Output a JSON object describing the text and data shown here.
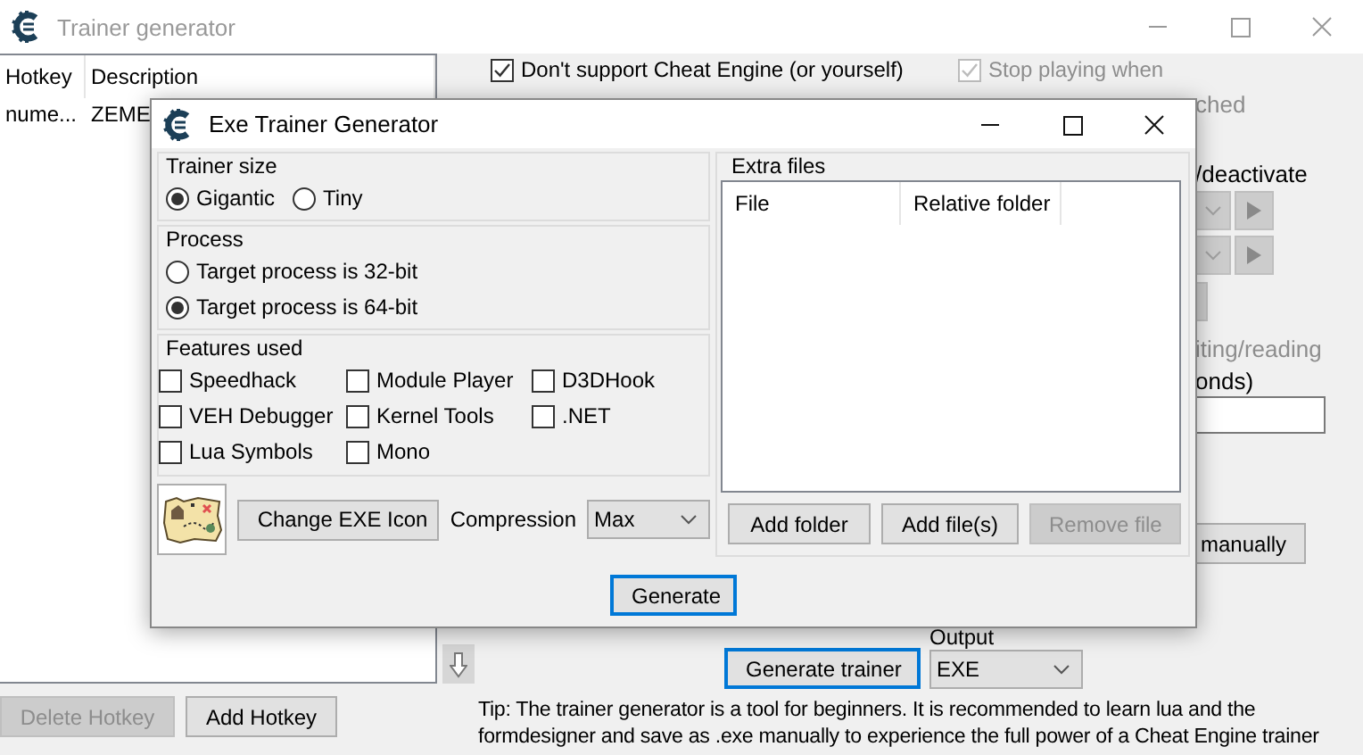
{
  "window": {
    "title": "Trainer generator",
    "active": false
  },
  "hotkey_list": {
    "columns": [
      "Hotkey",
      "Description"
    ],
    "rows": [
      [
        "nume...",
        "ZEME"
      ]
    ]
  },
  "hotkey_buttons": [
    {
      "label": "Delete Hotkey",
      "disabled": true
    },
    {
      "label": "Add Hotkey",
      "disabled": false
    }
  ],
  "options": [
    {
      "label": "Don't support Cheat Engine (or yourself)",
      "checked": true,
      "disabled": false
    },
    {
      "label": "Stop playing when",
      "checked": true,
      "disabled": true
    }
  ],
  "attach_option": {
    "text": "ched",
    "disabled": true
  },
  "activation_label": {
    "text": "/deactivate",
    "disabled": false
  },
  "delay_label": {
    "text": "iting/reading",
    "disabled": true
  },
  "delay_unit": {
    "text": "onds)",
    "disabled": false
  },
  "manual_button": "manually",
  "output": {
    "label": "Output",
    "value": "EXE"
  },
  "generate_trainer_button": {
    "label": "Generate trainer",
    "default": true
  },
  "tip": "Tip: The trainer generator is a tool for beginners. It is recommended to learn lua and the formdesigner and save as .exe manually to experience the full power of a Cheat Engine trainer",
  "dialog": {
    "title": "Exe Trainer Generator",
    "trainer_size": {
      "label": "Trainer size",
      "options": [
        {
          "label": "Gigantic",
          "selected": true
        },
        {
          "label": "Tiny",
          "selected": false
        }
      ]
    },
    "process": {
      "label": "Process",
      "options": [
        {
          "label": "Target process is 32-bit",
          "selected": false
        },
        {
          "label": "Target process is 64-bit",
          "selected": true
        }
      ]
    },
    "features": {
      "label": "Features used",
      "items": [
        {
          "label": "Speedhack",
          "checked": false
        },
        {
          "label": "Module Player",
          "checked": false
        },
        {
          "label": "D3DHook",
          "checked": false
        },
        {
          "label": "VEH Debugger",
          "checked": false
        },
        {
          "label": "Kernel Tools",
          "checked": false
        },
        {
          "label": ".NET",
          "checked": false
        },
        {
          "label": "Lua Symbols",
          "checked": false
        },
        {
          "label": "Mono",
          "checked": false
        }
      ]
    },
    "change_icon_button": "Change EXE Icon",
    "compression": {
      "label": "Compression",
      "value": "Max"
    },
    "extra_files": {
      "label": "Extra files",
      "columns": [
        "File",
        "Relative folder"
      ],
      "buttons": [
        {
          "label": "Add folder",
          "disabled": false
        },
        {
          "label": "Add file(s)",
          "disabled": false
        },
        {
          "label": "Remove file",
          "disabled": true
        }
      ]
    },
    "generate_button": {
      "label": "Generate",
      "default": true
    }
  }
}
